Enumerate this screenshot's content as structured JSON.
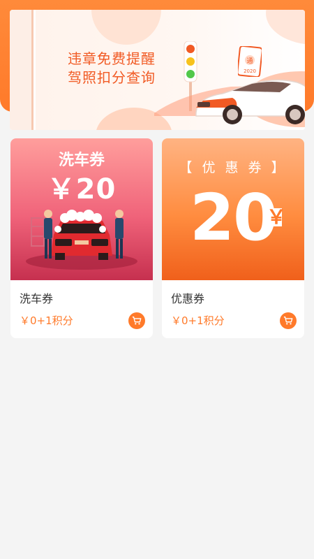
{
  "banner": {
    "line1": "违章免费提醒",
    "line2": "驾照扣分查询",
    "badge_char": "通",
    "badge_year": "2020"
  },
  "products": [
    {
      "name": "洗车券",
      "price": "￥0+1积分",
      "image_title": "洗车券",
      "image_value": "￥20"
    },
    {
      "name": "优惠券",
      "price": "￥0+1积分",
      "image_title": "【 优 惠 券 】",
      "image_value": "20",
      "image_currency": "￥"
    }
  ],
  "colors": {
    "accent": "#ff7a2a",
    "header": "#ff8a3a",
    "wash_gradient_end": "#c6304f",
    "coupon_gradient_end": "#f0601b",
    "background": "#f4f4f4"
  },
  "icons": {
    "cart": "shopping-cart-icon",
    "traffic_light": "traffic-light-icon",
    "car": "car-illustration"
  }
}
